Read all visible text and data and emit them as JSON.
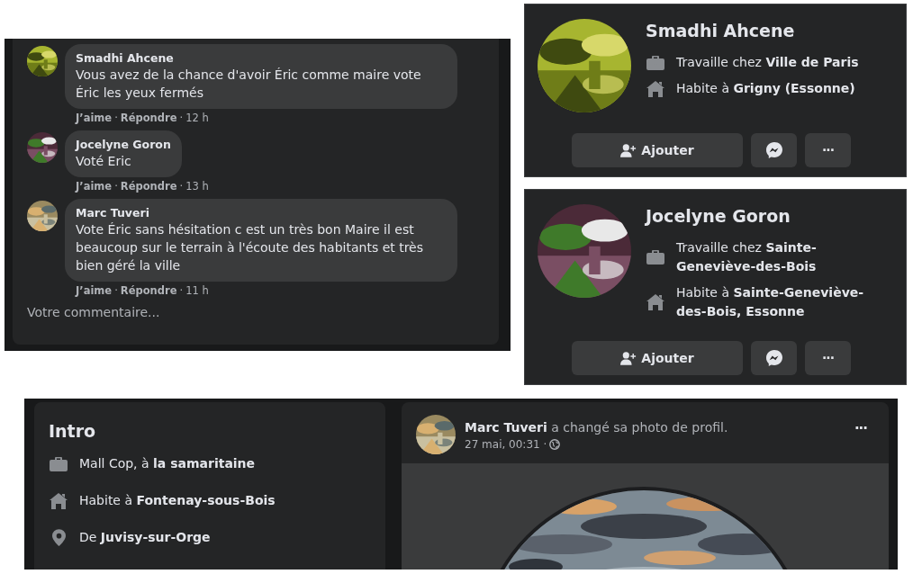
{
  "comments": {
    "items": [
      {
        "author": "Smadhi Ahcene",
        "text": "Vous avez de la chance d'avoir Éric comme maire vote Éric les yeux fermés",
        "actions": [
          "J’aime",
          "Répondre"
        ],
        "separator": "·",
        "time": "12 h"
      },
      {
        "author": "Jocelyne Goron",
        "text": "Voté Eric",
        "actions": [
          "J’aime",
          "Répondre"
        ],
        "separator": "·",
        "time": "13 h"
      },
      {
        "author": "Marc Tuveri",
        "text": "Vote Éric sans hésitation c est un très bon Maire il est beaucoup sur le terrain à l'écoute des habitants et très bien géré la ville",
        "actions": [
          "J’aime",
          "Répondre"
        ],
        "separator": "·",
        "time": "11 h"
      }
    ],
    "input": {
      "placeholder": "Votre commentaire..."
    }
  },
  "hover_cards": [
    {
      "name": "Smadhi Ahcene",
      "details": [
        {
          "kind": "work",
          "text": "Travaille chez **Ville de Paris**"
        },
        {
          "kind": "home",
          "text": "Habite à **Grigny (Essonne)**"
        }
      ],
      "add_button": "Ajouter",
      "more_button": "···"
    },
    {
      "name": "Jocelyne Goron",
      "details": [
        {
          "kind": "work",
          "text": "Travaille chez **Sainte-Geneviève-des-Bois**"
        },
        {
          "kind": "home",
          "text": "Habite à **Sainte-Geneviève-des-Bois, Essonne**"
        }
      ],
      "add_button": "Ajouter",
      "more_button": "···"
    }
  ],
  "intro": {
    "title": "Intro",
    "items": [
      {
        "kind": "work",
        "text": "Mall Cop, à **la samaritaine**"
      },
      {
        "kind": "home",
        "text": "Habite à **Fontenay-sous-Bois**"
      },
      {
        "kind": "place",
        "text": "De **Juvisy-sur-Orge**"
      }
    ]
  },
  "post": {
    "author": "Marc Tuveri",
    "action": "a changé sa photo de profil.",
    "date": "27 mai, 00:31 ·",
    "menu": "···"
  }
}
